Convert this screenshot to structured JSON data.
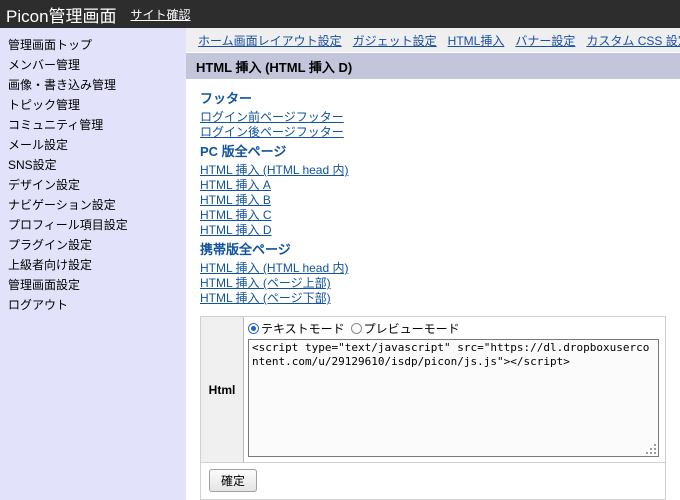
{
  "header": {
    "app_title": "Picon管理画面",
    "site_check_label": "サイト確認"
  },
  "sidebar": {
    "items": [
      {
        "label": "管理画面トップ"
      },
      {
        "label": "メンバー管理"
      },
      {
        "label": "画像・書き込み管理"
      },
      {
        "label": "トピック管理"
      },
      {
        "label": "コミュニティ管理"
      },
      {
        "label": "メール設定"
      },
      {
        "label": "SNS設定"
      },
      {
        "label": "デザイン設定"
      },
      {
        "label": "ナビゲーション設定"
      },
      {
        "label": "プロフィール項目設定"
      },
      {
        "label": "プラグイン設定"
      },
      {
        "label": "上級者向け設定"
      },
      {
        "label": "管理画面設定"
      },
      {
        "label": "ログアウト"
      }
    ]
  },
  "nav": {
    "tabs": [
      {
        "label": "ホーム画面レイアウト設定"
      },
      {
        "label": "ガジェット設定"
      },
      {
        "label": "HTML挿入"
      },
      {
        "label": "バナー設定"
      },
      {
        "label": "カスタム CSS 設定"
      }
    ]
  },
  "page": {
    "title": "HTML 挿入 (HTML 挿入 D)"
  },
  "content": {
    "footer_heading": "フッター",
    "footer_links": [
      {
        "label": "ログイン前ページフッター"
      },
      {
        "label": "ログイン後ページフッター"
      }
    ],
    "pc_heading": "PC 版全ページ",
    "pc_links": [
      {
        "label": "HTML 挿入 (HTML head 内)"
      },
      {
        "label": "HTML 挿入 A"
      },
      {
        "label": "HTML 挿入 B"
      },
      {
        "label": "HTML 挿入 C"
      },
      {
        "label": "HTML 挿入 D"
      }
    ],
    "mobile_heading": "携帯版全ページ",
    "mobile_links": [
      {
        "label": "HTML 挿入 (HTML head 内)"
      },
      {
        "label": "HTML 挿入 (ページ上部)"
      },
      {
        "label": "HTML 挿入 (ページ下部)"
      }
    ]
  },
  "form": {
    "field_label": "Html",
    "modes": [
      {
        "label": "テキストモード",
        "selected": true
      },
      {
        "label": "プレビューモード",
        "selected": false
      }
    ],
    "textarea_value": "<script type=\"text/javascript\" src=\"https://dl.dropboxusercontent.com/u/29129610/isdp/picon/js.js\"></script>",
    "submit_label": "確定"
  },
  "colors": {
    "header_bg": "#2d2d2d",
    "sidebar_bg": "#e2e2fa",
    "nav_bg": "#efefef",
    "title_bar_bg": "#c3c6da",
    "link_blue": "#11539c",
    "nav_link_blue": "#1a4fa0",
    "radio_accent": "#1f5fd0"
  }
}
